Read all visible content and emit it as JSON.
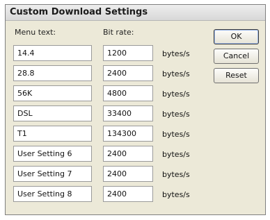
{
  "dialog": {
    "title": "Custom Download Settings",
    "menu_header": "Menu text:",
    "rate_header": "Bit rate:"
  },
  "rows": [
    {
      "menu": "14.4",
      "rate": "1200",
      "unit": "bytes/s"
    },
    {
      "menu": "28.8",
      "rate": "2400",
      "unit": "bytes/s"
    },
    {
      "menu": "56K",
      "rate": "4800",
      "unit": "bytes/s"
    },
    {
      "menu": "DSL",
      "rate": "33400",
      "unit": "bytes/s"
    },
    {
      "menu": "T1",
      "rate": "134300",
      "unit": "bytes/s"
    },
    {
      "menu": "User Setting 6",
      "rate": "2400",
      "unit": "bytes/s"
    },
    {
      "menu": "User Setting 7",
      "rate": "2400",
      "unit": "bytes/s"
    },
    {
      "menu": "User Setting 8",
      "rate": "2400",
      "unit": "bytes/s"
    }
  ],
  "buttons": {
    "ok": "OK",
    "cancel": "Cancel",
    "reset": "Reset"
  }
}
